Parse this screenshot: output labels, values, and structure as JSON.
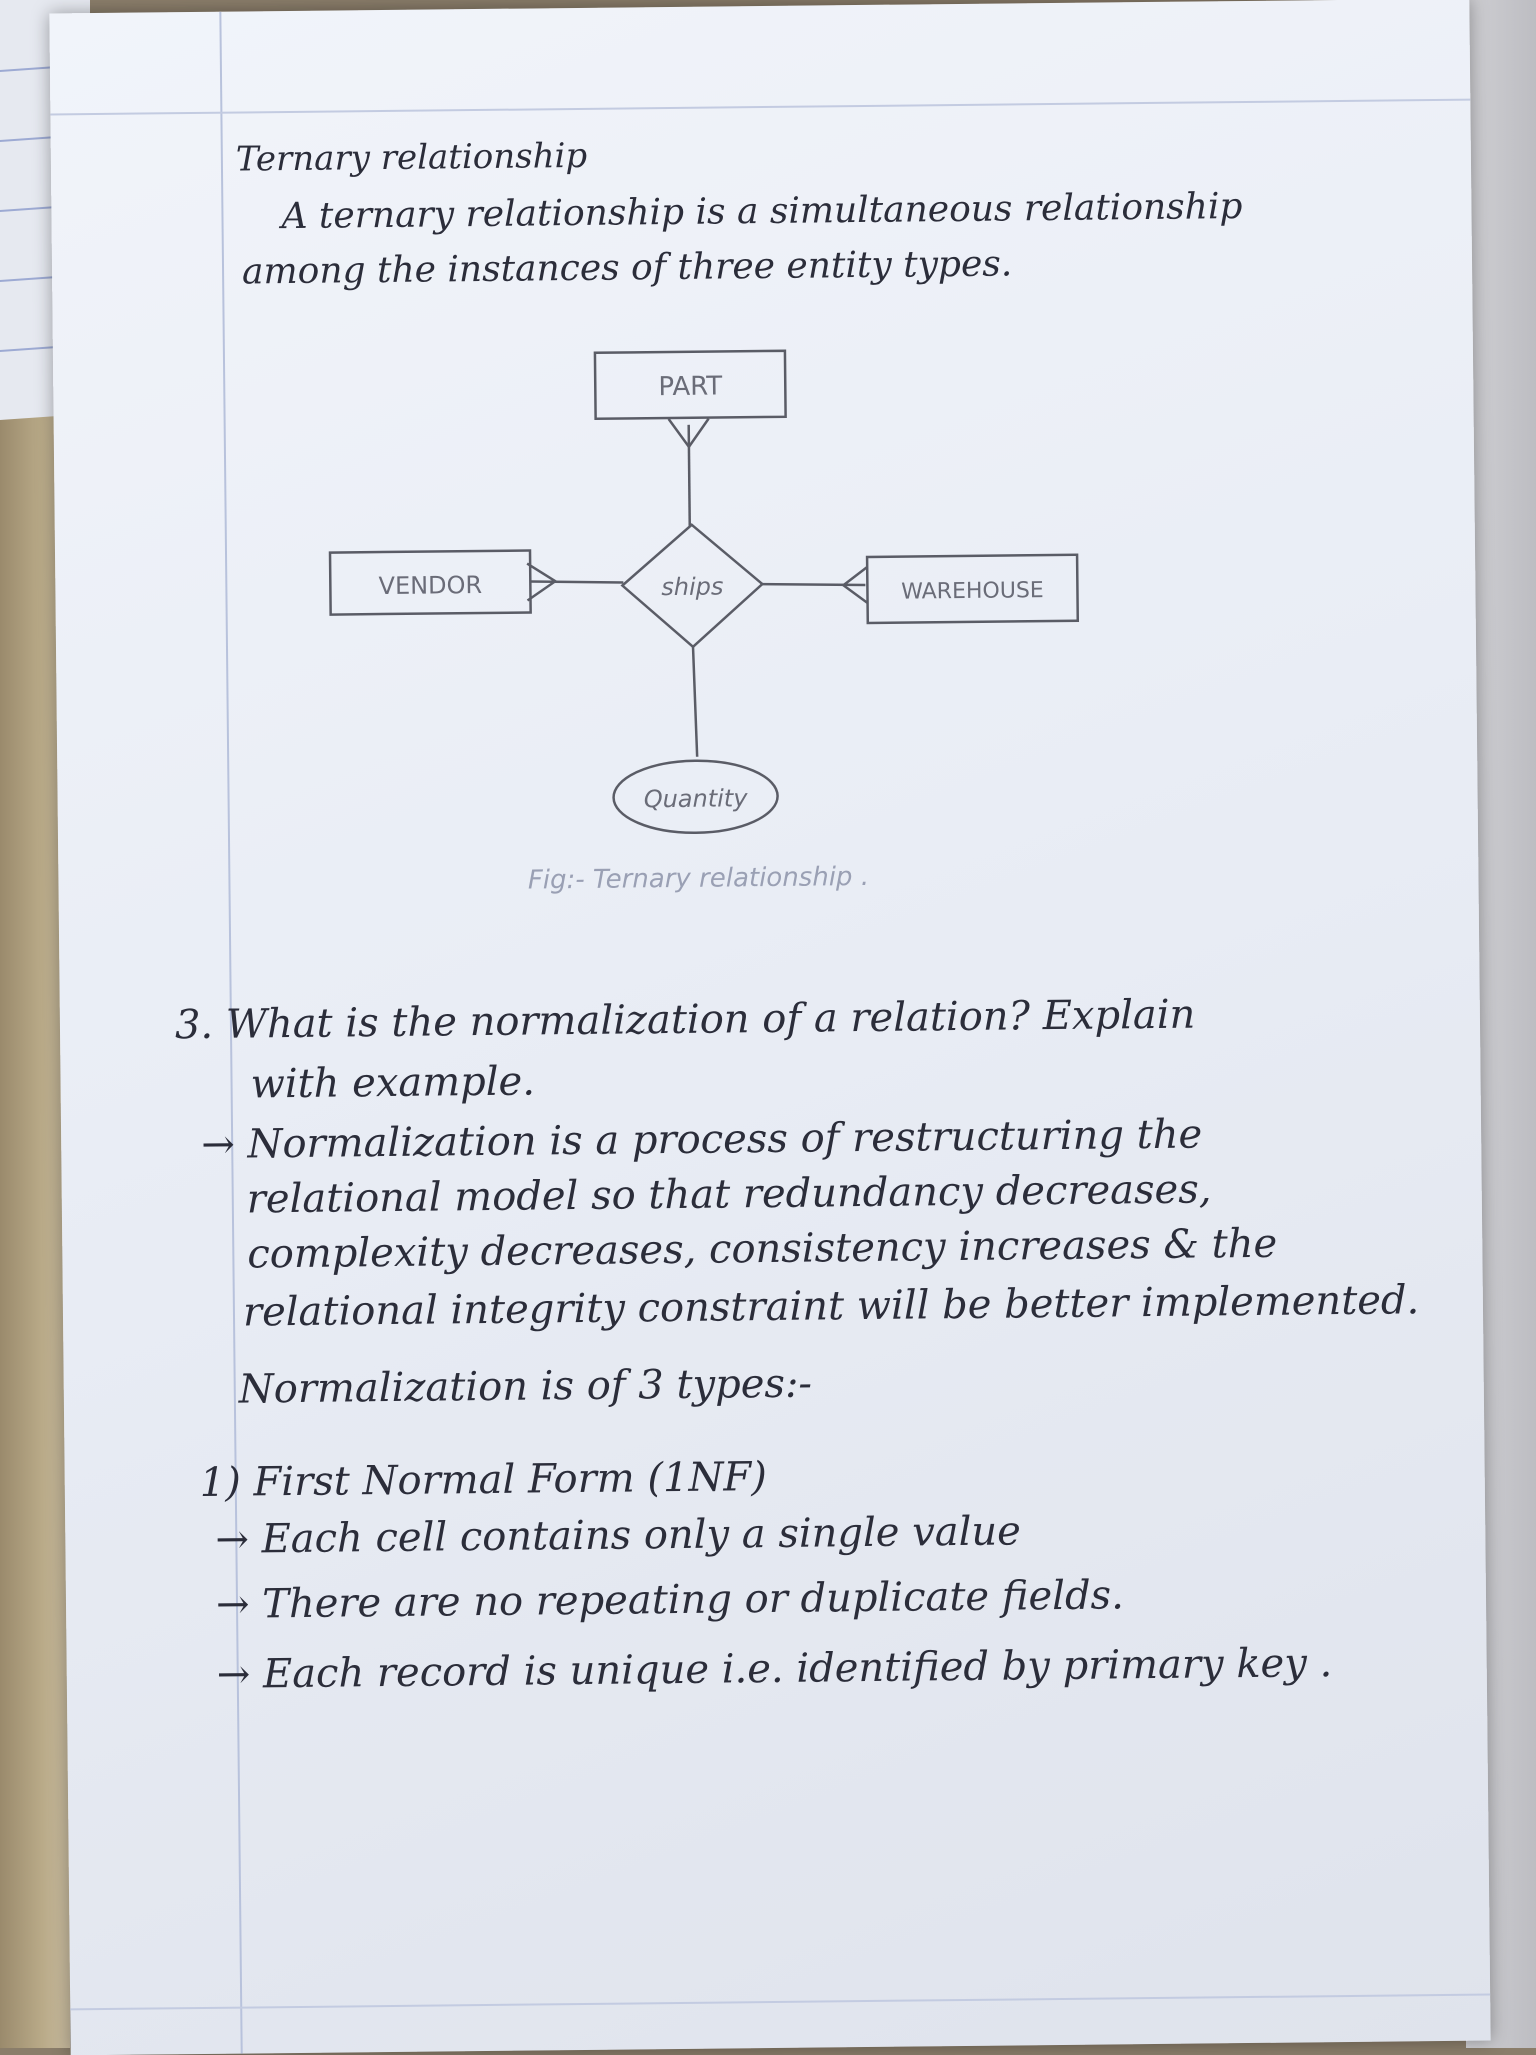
{
  "notes": {
    "ternary_heading": "Ternary relationship",
    "ternary_def_line1": "A ternary relationship is a simultaneous relationship",
    "ternary_def_line2": "among the instances of three entity types.",
    "diagram": {
      "entity_part": "PART",
      "entity_vendor": "VENDOR",
      "entity_warehouse": "WAREHOUSE",
      "relationship": "ships",
      "attribute": "Quantity",
      "caption": "Fig:- Ternary relationship ."
    },
    "question_line1": "3. What is the normalization of a relation? Explain",
    "question_line2": "with example.",
    "answer_line1": "→ Normalization is a process of restructuring the",
    "answer_line2": "relational model so that redundancy decreases,",
    "answer_line3": "complexity decreases, consistency increases & the",
    "answer_line4": "relational integrity constraint will be better implemented.",
    "types_line": "Normalization is of 3 types:-",
    "nf1_heading": "1) First Normal Form (1NF)",
    "bullet1": "→ Each cell contains only a single value",
    "bullet2": "→ There are no repeating or duplicate fields.",
    "bullet3": "→ Each record is unique i.e. identified by primary key ."
  }
}
